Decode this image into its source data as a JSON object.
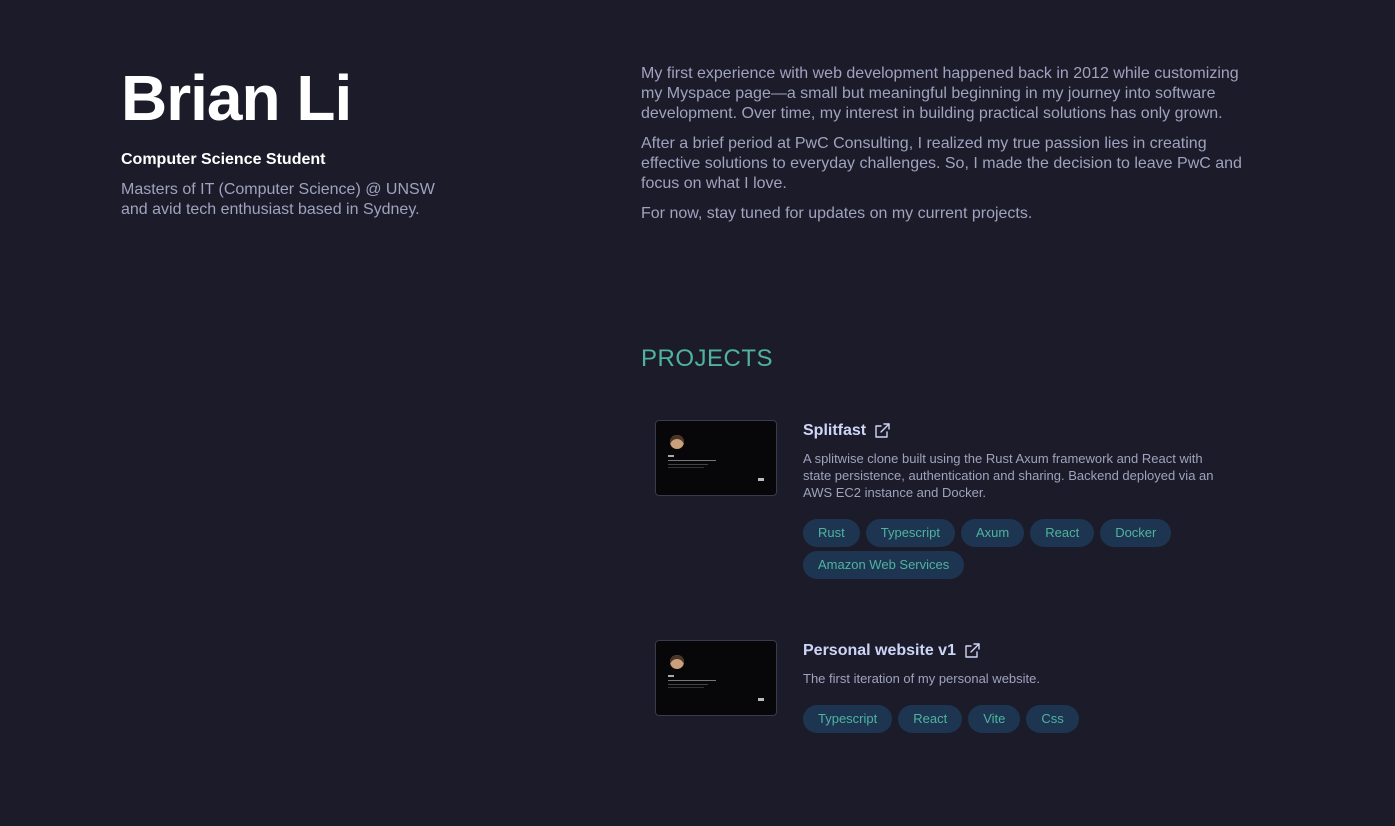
{
  "profile": {
    "name": "Brian Li",
    "role": "Computer Science Student",
    "tagline": "Masters of IT (Computer Science) @ UNSW and avid tech enthusiast based in Sydney."
  },
  "about": {
    "paragraphs": [
      "My first experience with web development happened back in 2012 while customizing my Myspace page—a small but meaningful beginning in my journey into software development. Over time, my interest in building practical solutions has only grown.",
      "After a brief period at PwC Consulting, I realized my true passion lies in creating effective solutions to everyday challenges. So, I made the decision to leave PwC and focus on what I love.",
      "For now, stay tuned for updates on my current projects."
    ]
  },
  "projects": {
    "heading": "PROJECTS",
    "items": [
      {
        "title": "Splitfast",
        "description": "A splitwise clone built using the Rust Axum framework and React with state persistence, authentication and sharing. Backend deployed via an AWS EC2 instance and Docker.",
        "tags": [
          "Rust",
          "Typescript",
          "Axum",
          "React",
          "Docker",
          "Amazon Web Services"
        ]
      },
      {
        "title": "Personal website v1",
        "description": "The first iteration of my personal website.",
        "tags": [
          "Typescript",
          "React",
          "Vite",
          "Css"
        ]
      }
    ]
  },
  "colors": {
    "background": "#1c1b29",
    "accent": "#4fb3a0",
    "tag_background": "#1d3550",
    "text": "#9ea3be",
    "heading": "#ffffff"
  }
}
